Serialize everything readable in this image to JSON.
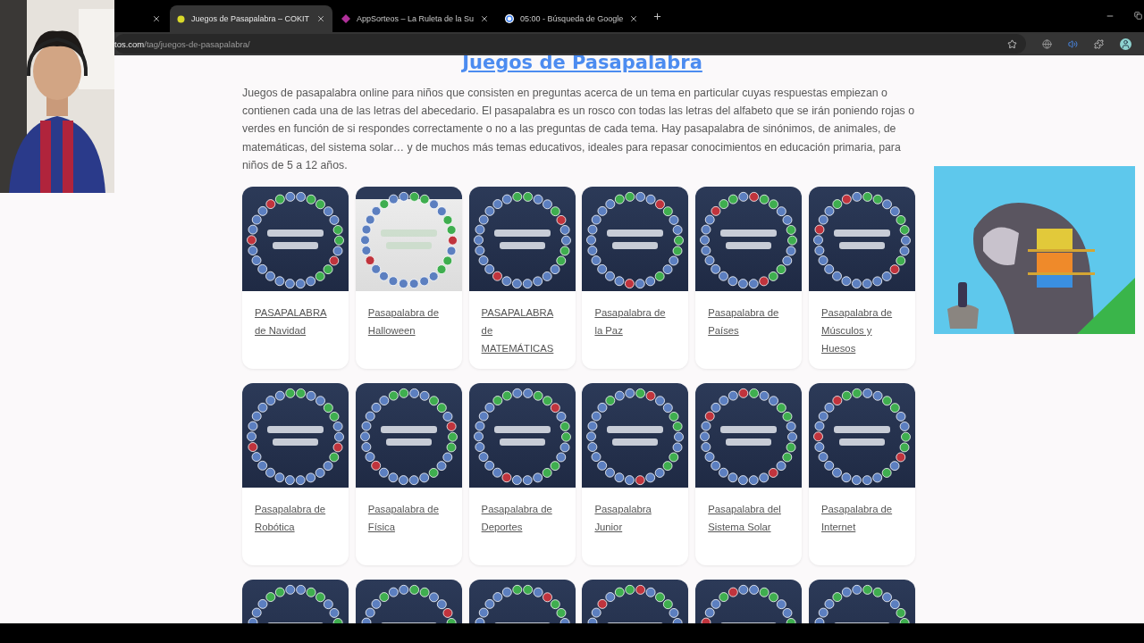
{
  "browser": {
    "tabs": [
      {
        "selected": false
      },
      {
        "title": "Juegos de Pasapalabra – COKIT",
        "selected": true
      },
      {
        "title": "AppSorteos – La Ruleta de la Su",
        "selected": false
      },
      {
        "title": "05:00 - Búsqueda de Google",
        "selected": false
      }
    ],
    "url_host": "tos.com",
    "url_path": "/tag/juegos-de-pasapalabra/"
  },
  "webcam": {
    "kind": "picture"
  },
  "page": {
    "heading": "Juegos de Pasapalabra",
    "intro": "Juegos de pasapalabra online para niños que consisten en preguntas acerca de un tema en particular cuyas respuestas empiezan o contienen cada una de las letras del abecedario. El pasapalabra es un rosco con todas las letras del alfabeto que se irán poniendo rojas o verdes en función de si respondes correctamente o no a las preguntas de cada tema. Hay pasapalabra de sinónimos, de animales, de matemáticas, del sistema solar… y de muchos más temas educativos, ideales para repasar conocimientos en educación primaria, para niños de 5 a 12 años.",
    "cards": [
      {
        "kind": "picture",
        "caption": "PASAPALABRA de Navidad"
      },
      {
        "kind": "picture",
        "caption": "Pasapalabra de Halloween",
        "light": true
      },
      {
        "kind": "picture",
        "caption": "PASAPALABRA de MATEMÁTICAS"
      },
      {
        "kind": "picture",
        "caption": "Pasapalabra de la Paz"
      },
      {
        "kind": "picture",
        "caption": "Pasapalabra de Países"
      },
      {
        "kind": "picture",
        "caption": "Pasapalabra de Músculos y Huesos"
      },
      {
        "kind": "picture",
        "caption": "Pasapalabra de Robótica"
      },
      {
        "kind": "picture",
        "caption": "Pasapalabra de Física"
      },
      {
        "kind": "picture",
        "caption": "Pasapalabra de Deportes"
      },
      {
        "kind": "picture",
        "caption": "Pasapalabra Junior"
      },
      {
        "kind": "picture",
        "caption": "Pasapalabra del Sistema Solar"
      },
      {
        "kind": "picture",
        "caption": "Pasapalabra de Internet"
      },
      {
        "kind": "picture"
      },
      {
        "kind": "picture"
      },
      {
        "kind": "picture"
      },
      {
        "kind": "picture"
      },
      {
        "kind": "picture"
      },
      {
        "kind": "picture"
      }
    ]
  },
  "ad": {
    "kind": "picture"
  }
}
